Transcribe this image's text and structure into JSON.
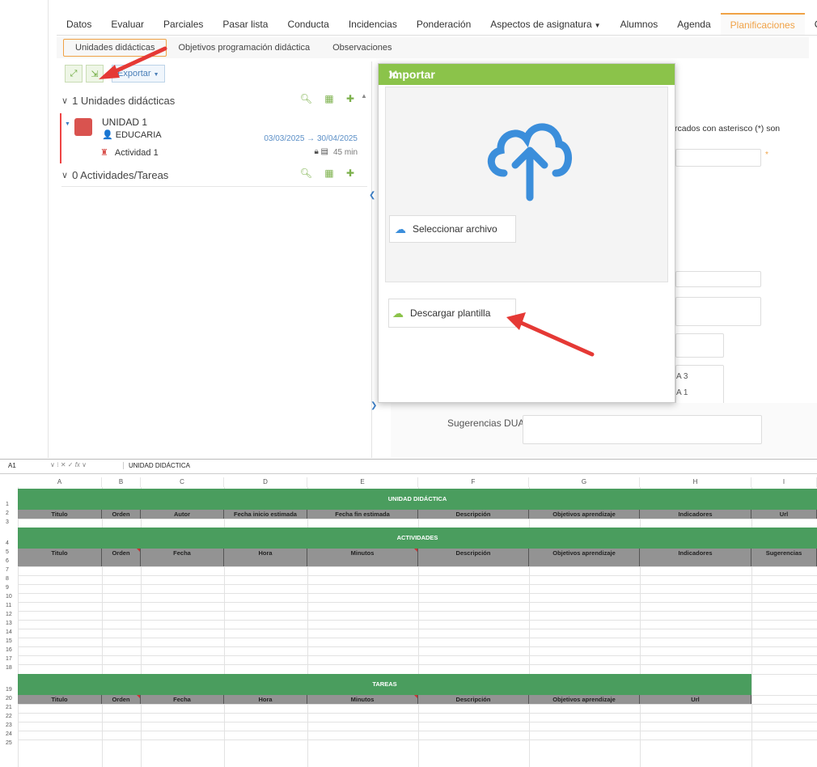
{
  "app": {
    "nav_tabs": [
      "Datos",
      "Evaluar",
      "Parciales",
      "Pasar lista",
      "Conducta",
      "Incidencias",
      "Ponderación",
      "Aspectos de asignatura",
      "Alumnos",
      "Agenda",
      "Planificaciones",
      "Cobe"
    ],
    "active_tab": "Planificaciones",
    "sub_tabs": [
      "Unidades didácticas",
      "Objetivos programación didáctica",
      "Observaciones"
    ],
    "export_label": "Exportar",
    "units_header": "1 Unidades didácticas",
    "activities_header": "0 Actividades/Tareas",
    "unit": {
      "title": "UNIDAD 1",
      "author": "EDUCARIA",
      "dates": "03/03/2025 → 30/04/2025",
      "activity": "Actividad 1",
      "minutes": "45 min"
    },
    "right_text": "rcados con asterisco (*) son",
    "tags": [
      "A 3",
      "A 1"
    ],
    "dua_label": "Sugerencias DUA:"
  },
  "modal": {
    "title": "Importar",
    "select_file": "Seleccionar archivo",
    "download_template": "Descargar plantilla"
  },
  "sheet": {
    "cell_ref": "A1",
    "fx": "fx",
    "formula_value": "UNIDAD DIDÁCTICA",
    "columns": [
      "A",
      "B",
      "C",
      "D",
      "E",
      "F",
      "G",
      "H",
      "I"
    ],
    "unidad_title": "UNIDAD DIDÁCTICA",
    "unidad_headers": [
      "Titulo",
      "Orden",
      "Autor",
      "Fecha inicio estimada",
      "Fecha fin estimada",
      "Descripción",
      "Objetivos aprendizaje",
      "Indicadores",
      "Url"
    ],
    "actividades_title": "ACTIVIDADES",
    "actividades_headers": [
      "Titulo",
      "Orden",
      "Fecha",
      "Hora",
      "Minutos",
      "Descripción",
      "Objetivos aprendizaje",
      "Indicadores",
      "Sugerencias"
    ],
    "tareas_title": "TAREAS",
    "tareas_headers": [
      "Titulo",
      "Orden",
      "Fecha",
      "Hora",
      "Minutos",
      "Descripción",
      "Objetivos aprendizaje",
      "Url"
    ],
    "row_numbers": [
      "1",
      "2",
      "3",
      "4",
      "5",
      "6",
      "7",
      "8",
      "9",
      "10",
      "11",
      "12",
      "13",
      "14",
      "15",
      "16",
      "17",
      "18",
      "19",
      "20",
      "21",
      "22",
      "23",
      "24",
      "25"
    ]
  },
  "colors": {
    "accent_orange": "#f0a246",
    "modal_green": "#8bc34a",
    "sheet_green": "#4a9d5e",
    "arrow_red": "#e53935"
  }
}
